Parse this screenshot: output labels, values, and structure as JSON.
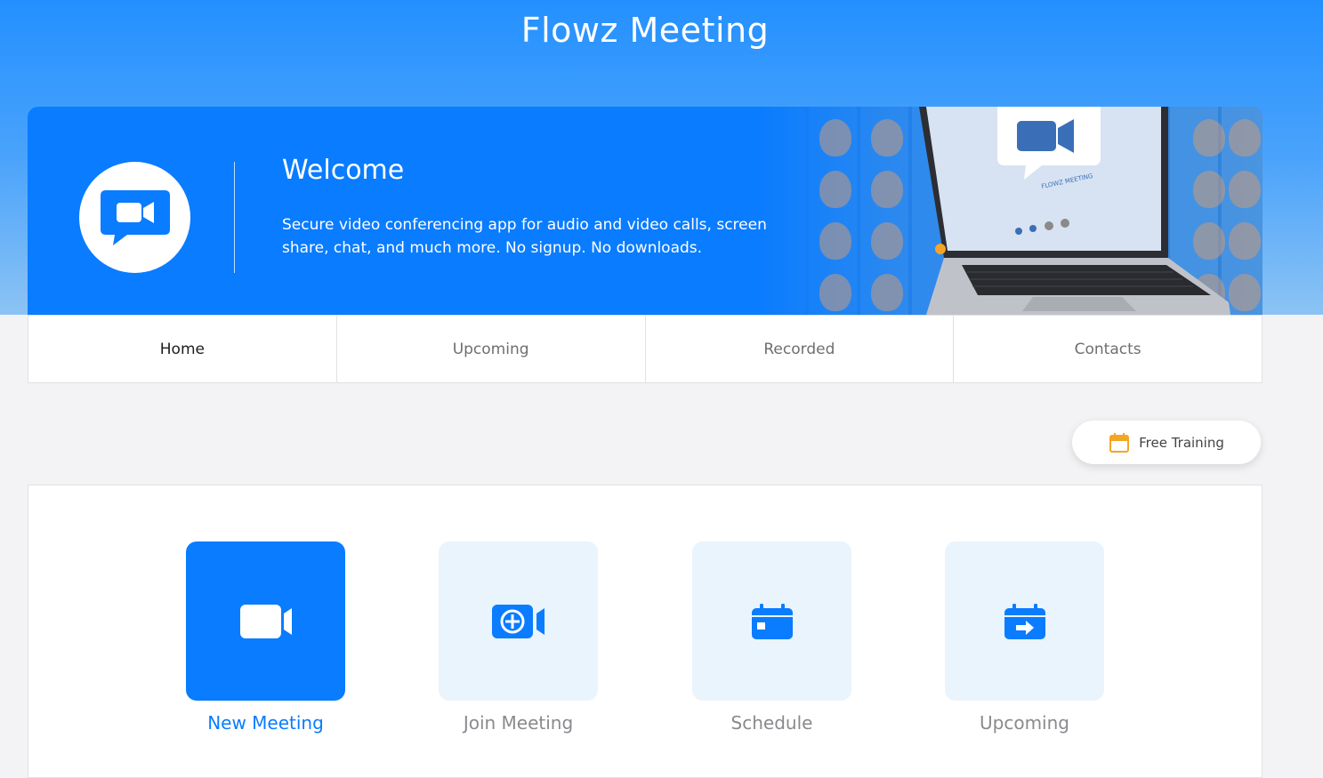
{
  "app": {
    "title": "Flowz Meeting"
  },
  "hero": {
    "title": "Welcome",
    "description": "Secure video conferencing app for audio and video calls, screen share, chat, and much more. No signup. No downloads.",
    "laptop_brand": "FLOWZ MEETING"
  },
  "tabs": [
    {
      "label": "Home",
      "active": true
    },
    {
      "label": "Upcoming",
      "active": false
    },
    {
      "label": "Recorded",
      "active": false
    },
    {
      "label": "Contacts",
      "active": false
    }
  ],
  "free_training": {
    "label": "Free Training",
    "icon": "calendar-icon",
    "icon_color": "#f5a524"
  },
  "actions": [
    {
      "label": "New Meeting",
      "icon": "video-camera-icon",
      "primary": true
    },
    {
      "label": "Join Meeting",
      "icon": "video-add-icon",
      "primary": false
    },
    {
      "label": "Schedule",
      "icon": "calendar-icon",
      "primary": false
    },
    {
      "label": "Upcoming",
      "icon": "calendar-forward-icon",
      "primary": false
    }
  ],
  "colors": {
    "accent": "#0a7cff",
    "tile_bg": "#eaf4fc",
    "header_gradient_top": "#2390ff"
  }
}
